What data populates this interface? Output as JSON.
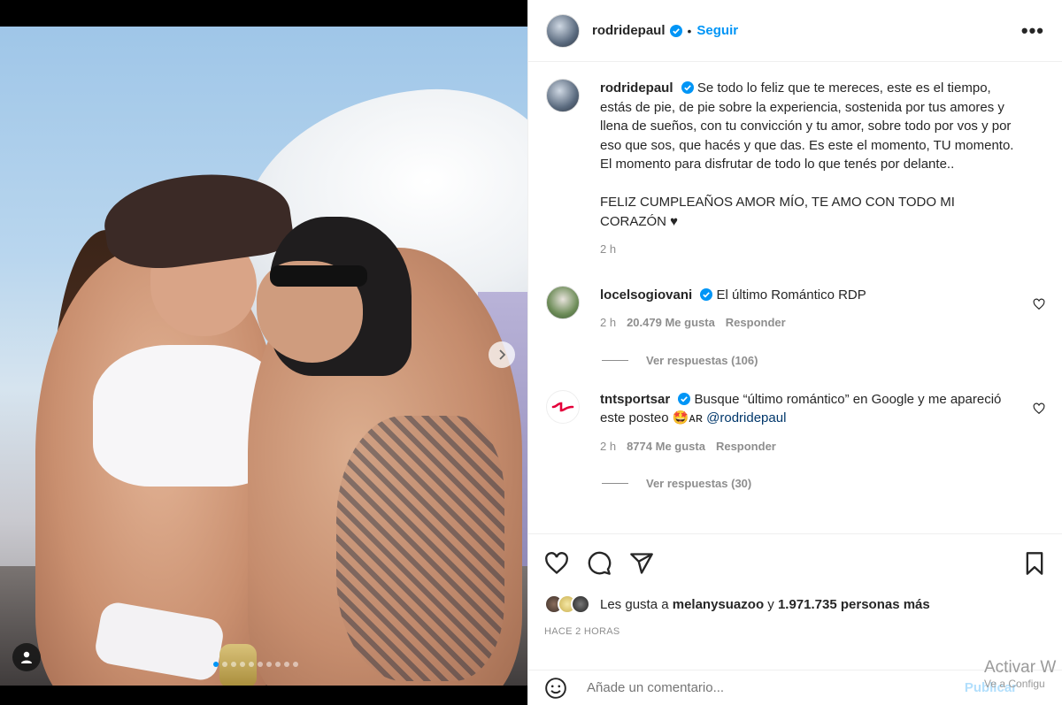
{
  "post": {
    "carousel_total": 10,
    "carousel_active": 0,
    "next_icon": "chevron-right-icon",
    "tag_icon": "user-tag-icon"
  },
  "header": {
    "username": "rodridepaul",
    "separator": "•",
    "follow_label": "Seguir",
    "more_label": "•••"
  },
  "caption": {
    "username": "rodridepaul",
    "text": "Se todo lo feliz que te mereces, este es el tiempo, estás de pie, de pie sobre la experiencia, sostenida por tus amores y llena de sueños, con tu convicción y tu amor, sobre todo por vos y por eso que sos, que hacés y que das. Es este el momento, TU momento. El momento para disfrutar de todo lo que tenés por delante..\n\nFELIZ CUMPLEAÑOS AMOR MÍO, TE AMO CON TODO MI CORAZÓN ♥",
    "time": "2 h"
  },
  "comments": [
    {
      "username": "locelsogiovani",
      "text": "El último Romántico RDP",
      "mention": "",
      "time": "2 h",
      "likes": "20.479 Me gusta",
      "reply_label": "Responder",
      "view_replies": "Ver respuestas (106)"
    },
    {
      "username": "tntsportsar",
      "text": "Busque “último romántico” en Google y me apareció este posteo 🤩ᴀʀ",
      "mention": "@rodridepaul",
      "time": "2 h",
      "likes": "8774 Me gusta",
      "reply_label": "Responder",
      "view_replies": "Ver respuestas (30)"
    }
  ],
  "actions": {
    "icons": [
      "heart-icon",
      "comment-icon",
      "share-icon",
      "bookmark-icon"
    ]
  },
  "likes": {
    "prefix": "Les gusta a",
    "user": "melanysuazoo",
    "connector": "y",
    "count": "1.971.735 personas más"
  },
  "posted_ago": "HACE 2 HORAS",
  "add_comment": {
    "placeholder": "Añade un comentario...",
    "publish_label": "Publicar"
  },
  "watermark": {
    "line1": "Activar W",
    "line2": "Ve a Configu"
  },
  "colors": {
    "accent": "#0095f6",
    "verified": "#0095f6",
    "muted": "#8e8e8e",
    "tnt_brand": "#e4003a"
  }
}
